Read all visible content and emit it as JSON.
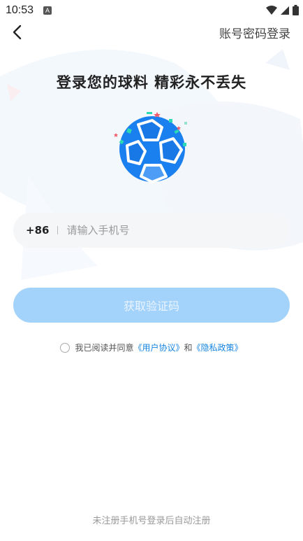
{
  "status_bar": {
    "time": "10:53",
    "notification_icon": "A"
  },
  "header": {
    "back_icon": "chevron-left-icon",
    "password_login_label": "账号密码登录"
  },
  "title": "登录您的球料 精彩永不丢失",
  "phone": {
    "country_code": "+86",
    "placeholder": "请输入手机号",
    "value": ""
  },
  "get_code_button": "获取验证码",
  "agreement": {
    "prefix": "我已阅读并同意",
    "user_agreement": "《用户协议》",
    "and": "和",
    "privacy_policy": "《隐私政策》"
  },
  "bottom_note": "未注册手机号登录后自动注册",
  "colors": {
    "accent": "#1684e0",
    "button_disabled": "#a3d2fb",
    "ball_blue": "#1a7fef"
  }
}
